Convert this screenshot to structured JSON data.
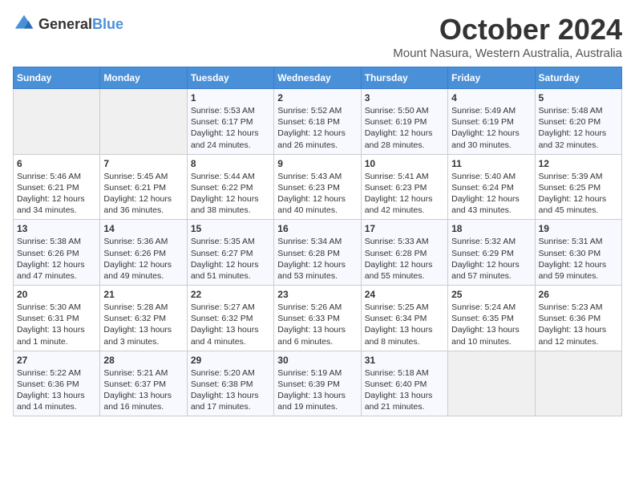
{
  "logo": {
    "general": "General",
    "blue": "Blue"
  },
  "title": "October 2024",
  "subtitle": "Mount Nasura, Western Australia, Australia",
  "days_header": [
    "Sunday",
    "Monday",
    "Tuesday",
    "Wednesday",
    "Thursday",
    "Friday",
    "Saturday"
  ],
  "weeks": [
    [
      {
        "day": "",
        "info": ""
      },
      {
        "day": "",
        "info": ""
      },
      {
        "day": "1",
        "info": "Sunrise: 5:53 AM\nSunset: 6:17 PM\nDaylight: 12 hours and 24 minutes."
      },
      {
        "day": "2",
        "info": "Sunrise: 5:52 AM\nSunset: 6:18 PM\nDaylight: 12 hours and 26 minutes."
      },
      {
        "day": "3",
        "info": "Sunrise: 5:50 AM\nSunset: 6:19 PM\nDaylight: 12 hours and 28 minutes."
      },
      {
        "day": "4",
        "info": "Sunrise: 5:49 AM\nSunset: 6:19 PM\nDaylight: 12 hours and 30 minutes."
      },
      {
        "day": "5",
        "info": "Sunrise: 5:48 AM\nSunset: 6:20 PM\nDaylight: 12 hours and 32 minutes."
      }
    ],
    [
      {
        "day": "6",
        "info": "Sunrise: 5:46 AM\nSunset: 6:21 PM\nDaylight: 12 hours and 34 minutes."
      },
      {
        "day": "7",
        "info": "Sunrise: 5:45 AM\nSunset: 6:21 PM\nDaylight: 12 hours and 36 minutes."
      },
      {
        "day": "8",
        "info": "Sunrise: 5:44 AM\nSunset: 6:22 PM\nDaylight: 12 hours and 38 minutes."
      },
      {
        "day": "9",
        "info": "Sunrise: 5:43 AM\nSunset: 6:23 PM\nDaylight: 12 hours and 40 minutes."
      },
      {
        "day": "10",
        "info": "Sunrise: 5:41 AM\nSunset: 6:23 PM\nDaylight: 12 hours and 42 minutes."
      },
      {
        "day": "11",
        "info": "Sunrise: 5:40 AM\nSunset: 6:24 PM\nDaylight: 12 hours and 43 minutes."
      },
      {
        "day": "12",
        "info": "Sunrise: 5:39 AM\nSunset: 6:25 PM\nDaylight: 12 hours and 45 minutes."
      }
    ],
    [
      {
        "day": "13",
        "info": "Sunrise: 5:38 AM\nSunset: 6:26 PM\nDaylight: 12 hours and 47 minutes."
      },
      {
        "day": "14",
        "info": "Sunrise: 5:36 AM\nSunset: 6:26 PM\nDaylight: 12 hours and 49 minutes."
      },
      {
        "day": "15",
        "info": "Sunrise: 5:35 AM\nSunset: 6:27 PM\nDaylight: 12 hours and 51 minutes."
      },
      {
        "day": "16",
        "info": "Sunrise: 5:34 AM\nSunset: 6:28 PM\nDaylight: 12 hours and 53 minutes."
      },
      {
        "day": "17",
        "info": "Sunrise: 5:33 AM\nSunset: 6:28 PM\nDaylight: 12 hours and 55 minutes."
      },
      {
        "day": "18",
        "info": "Sunrise: 5:32 AM\nSunset: 6:29 PM\nDaylight: 12 hours and 57 minutes."
      },
      {
        "day": "19",
        "info": "Sunrise: 5:31 AM\nSunset: 6:30 PM\nDaylight: 12 hours and 59 minutes."
      }
    ],
    [
      {
        "day": "20",
        "info": "Sunrise: 5:30 AM\nSunset: 6:31 PM\nDaylight: 13 hours and 1 minute."
      },
      {
        "day": "21",
        "info": "Sunrise: 5:28 AM\nSunset: 6:32 PM\nDaylight: 13 hours and 3 minutes."
      },
      {
        "day": "22",
        "info": "Sunrise: 5:27 AM\nSunset: 6:32 PM\nDaylight: 13 hours and 4 minutes."
      },
      {
        "day": "23",
        "info": "Sunrise: 5:26 AM\nSunset: 6:33 PM\nDaylight: 13 hours and 6 minutes."
      },
      {
        "day": "24",
        "info": "Sunrise: 5:25 AM\nSunset: 6:34 PM\nDaylight: 13 hours and 8 minutes."
      },
      {
        "day": "25",
        "info": "Sunrise: 5:24 AM\nSunset: 6:35 PM\nDaylight: 13 hours and 10 minutes."
      },
      {
        "day": "26",
        "info": "Sunrise: 5:23 AM\nSunset: 6:36 PM\nDaylight: 13 hours and 12 minutes."
      }
    ],
    [
      {
        "day": "27",
        "info": "Sunrise: 5:22 AM\nSunset: 6:36 PM\nDaylight: 13 hours and 14 minutes."
      },
      {
        "day": "28",
        "info": "Sunrise: 5:21 AM\nSunset: 6:37 PM\nDaylight: 13 hours and 16 minutes."
      },
      {
        "day": "29",
        "info": "Sunrise: 5:20 AM\nSunset: 6:38 PM\nDaylight: 13 hours and 17 minutes."
      },
      {
        "day": "30",
        "info": "Sunrise: 5:19 AM\nSunset: 6:39 PM\nDaylight: 13 hours and 19 minutes."
      },
      {
        "day": "31",
        "info": "Sunrise: 5:18 AM\nSunset: 6:40 PM\nDaylight: 13 hours and 21 minutes."
      },
      {
        "day": "",
        "info": ""
      },
      {
        "day": "",
        "info": ""
      }
    ]
  ]
}
